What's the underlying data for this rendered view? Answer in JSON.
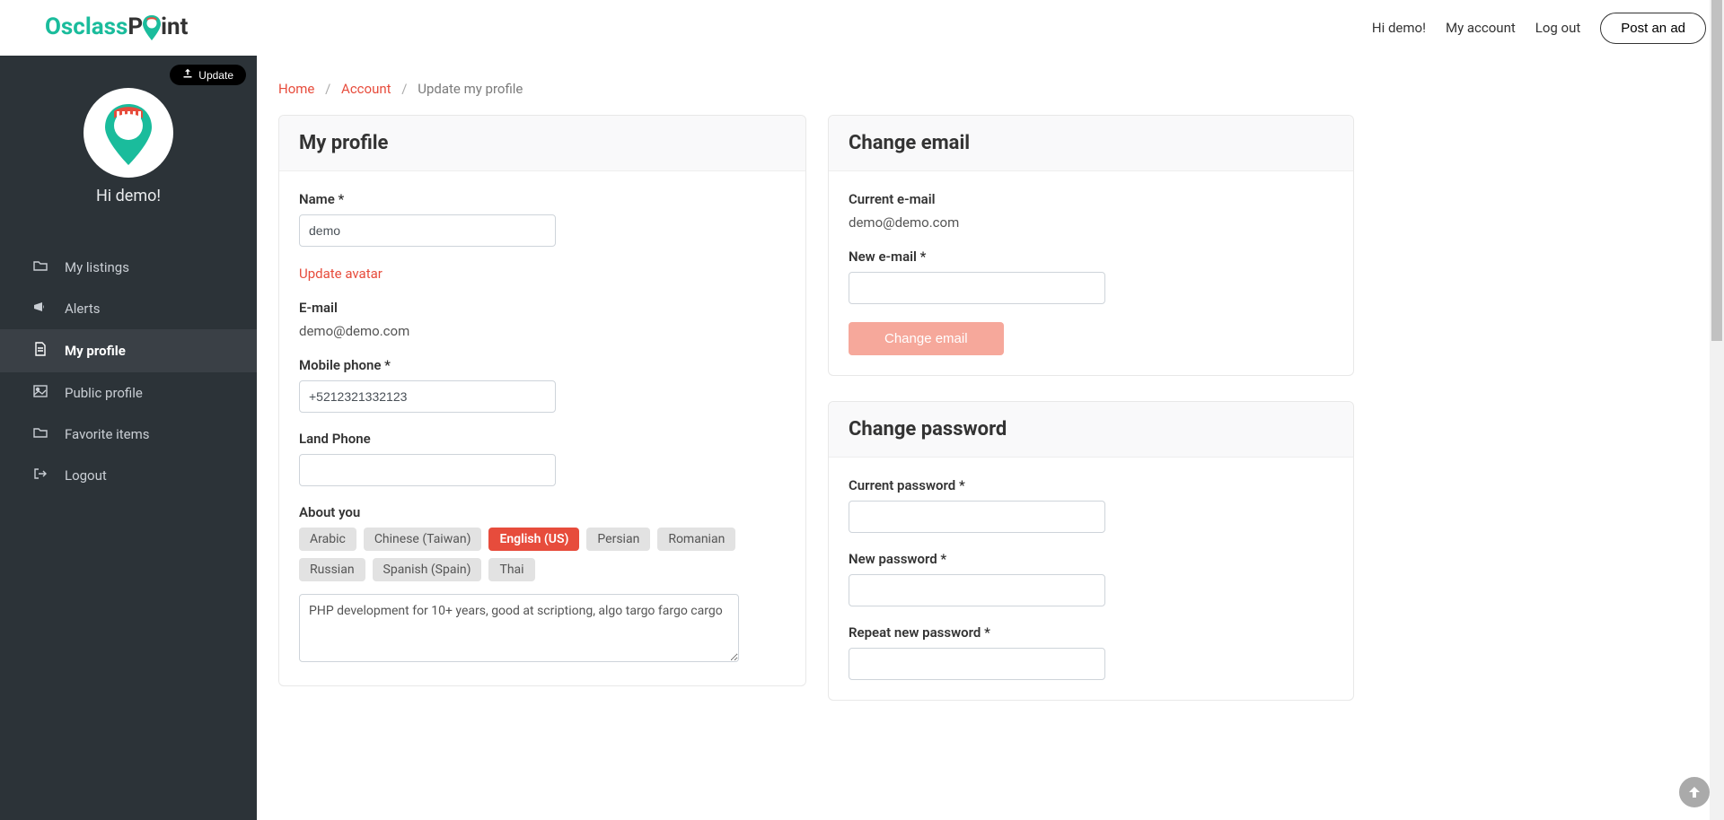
{
  "logo": {
    "part1": "Osclass",
    "part2": "P",
    "part3": "int"
  },
  "top_nav": {
    "hi": "Hi demo!",
    "my_account": "My account",
    "log_out": "Log out",
    "post_ad": "Post an ad"
  },
  "sidebar": {
    "update_label": "Update",
    "greeting": "Hi demo!",
    "items": [
      {
        "label": "My listings"
      },
      {
        "label": "Alerts"
      },
      {
        "label": "My profile"
      },
      {
        "label": "Public profile"
      },
      {
        "label": "Favorite items"
      },
      {
        "label": "Logout"
      }
    ]
  },
  "breadcrumb": {
    "home": "Home",
    "account": "Account",
    "current": "Update my profile"
  },
  "profile": {
    "title": "My profile",
    "name_label": "Name *",
    "name_value": "demo",
    "update_avatar": "Update avatar",
    "email_label": "E-mail",
    "email_value": "demo@demo.com",
    "mobile_label": "Mobile phone *",
    "mobile_value": "+5212321332123",
    "land_label": "Land Phone",
    "land_value": "",
    "about_label": "About you",
    "languages": [
      "Arabic",
      "Chinese (Taiwan)",
      "English (US)",
      "Persian",
      "Romanian",
      "Russian",
      "Spanish (Spain)",
      "Thai"
    ],
    "about_text": "PHP development for 10+ years, good at scriptiong, algo targo fargo cargo"
  },
  "change_email": {
    "title": "Change email",
    "current_label": "Current e-mail",
    "current_value": "demo@demo.com",
    "new_label": "New e-mail *",
    "button": "Change email"
  },
  "change_password": {
    "title": "Change password",
    "current_label": "Current password *",
    "new_label": "New password *",
    "repeat_label": "Repeat new password *"
  }
}
